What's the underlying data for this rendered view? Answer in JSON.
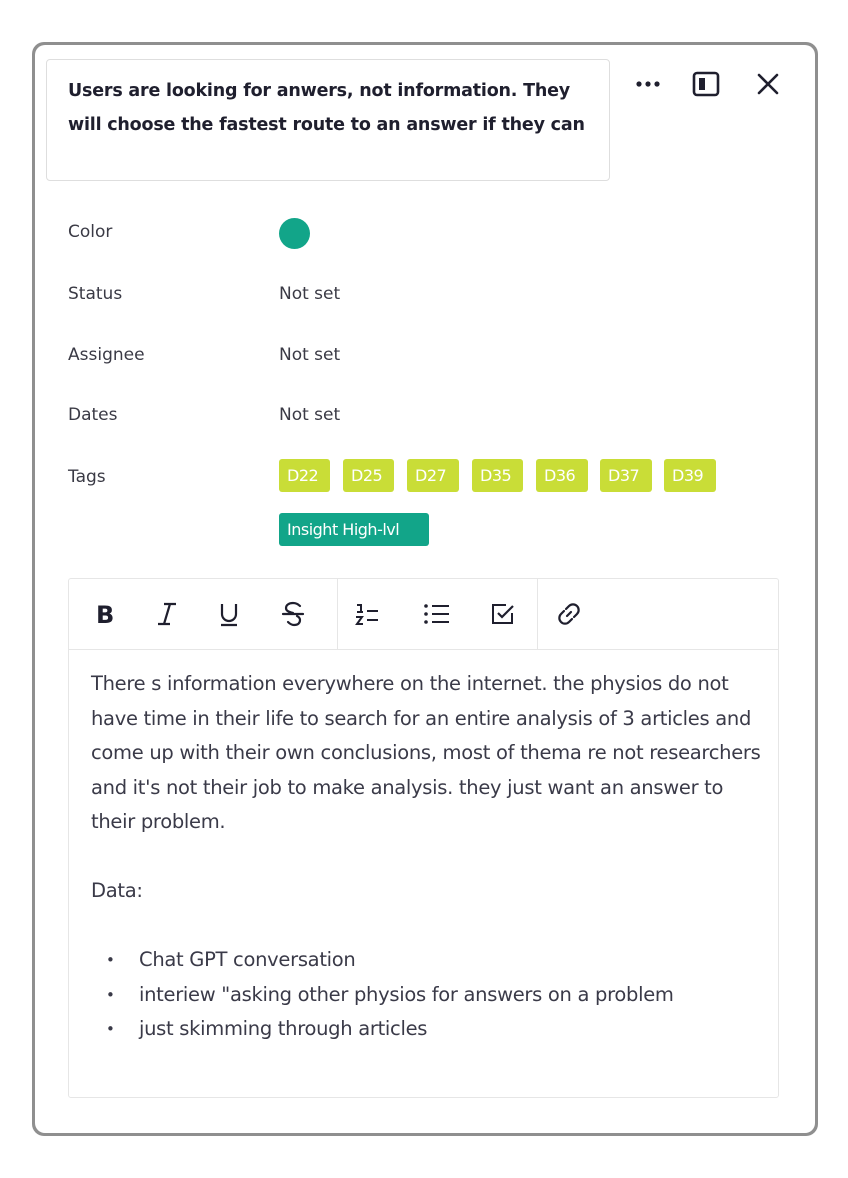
{
  "card": {
    "title": "Users are looking for anwers, not information. They will choose the fastest route to an answer if they can",
    "actions": {
      "more_icon": "more-horizontal-icon",
      "panel_icon": "side-panel-icon",
      "close_icon": "close-icon"
    }
  },
  "properties": {
    "color": {
      "label": "Color",
      "value_color": "#12a589"
    },
    "status": {
      "label": "Status",
      "value": "Not set"
    },
    "assignee": {
      "label": "Assignee",
      "value": "Not set"
    },
    "dates": {
      "label": "Dates",
      "value": "Not set"
    },
    "tags": {
      "label": "Tags",
      "items": [
        {
          "label": "D22",
          "color": "#c9dd37"
        },
        {
          "label": "D25",
          "color": "#c9dd37"
        },
        {
          "label": "D27",
          "color": "#c9dd37"
        },
        {
          "label": "D35",
          "color": "#c9dd37"
        },
        {
          "label": "D36",
          "color": "#c9dd37"
        },
        {
          "label": "D37",
          "color": "#c9dd37"
        },
        {
          "label": "D39",
          "color": "#c9dd37"
        },
        {
          "label": "Insight High-lvl",
          "color": "#12a589"
        }
      ]
    }
  },
  "toolbar": {
    "tools": [
      {
        "name": "bold",
        "icon": "bold-icon"
      },
      {
        "name": "italic",
        "icon": "italic-icon"
      },
      {
        "name": "underline",
        "icon": "underline-icon"
      },
      {
        "name": "strikethrough",
        "icon": "strikethrough-icon"
      },
      {
        "name": "ordered-list",
        "icon": "ordered-list-icon"
      },
      {
        "name": "bullet-list",
        "icon": "bullet-list-icon"
      },
      {
        "name": "checklist",
        "icon": "checkbox-icon"
      },
      {
        "name": "link",
        "icon": "link-icon"
      }
    ]
  },
  "editor": {
    "paragraph": "There s information everywhere on the internet. the physios do not have time in their life to search for an entire analysis of 3 articles and come up with their own conclusions, most of thema re not researchers and it's not their job to make analysis. they just want an answer to their problem.",
    "data_heading": "Data:",
    "bullets": [
      "Chat GPT conversation",
      "interiew \"asking other physios for answers on a problem",
      "just skimming through articles"
    ]
  }
}
